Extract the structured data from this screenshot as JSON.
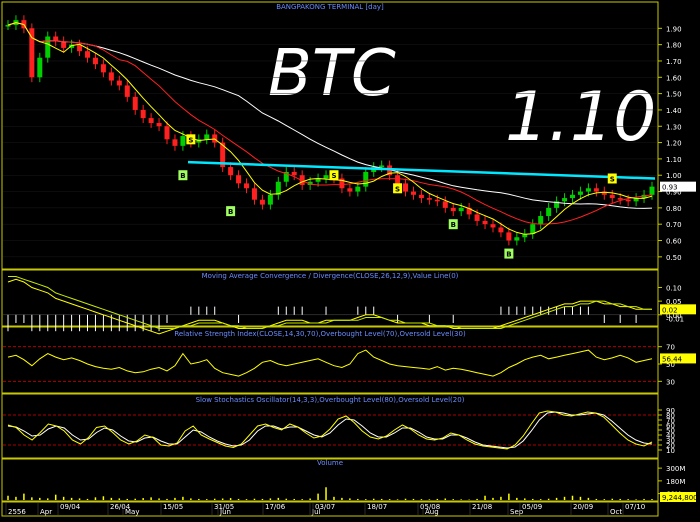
{
  "header": {
    "title": "BANGPAKONG TERMINAL [day]",
    "symbol": "BTC",
    "price": "1.10"
  },
  "colors": {
    "background": "#000000",
    "border": "#c8c800",
    "candle_up": "#00d000",
    "candle_down": "#ff2020",
    "ma_fast": "#ffff00",
    "ma_mid": "#ff2020",
    "ma_slow": "#ffffff",
    "trendline": "#00e8ff",
    "signal_box": "#ffff00",
    "signal_box_buy": "#a0ff60",
    "grid_red": "#b00000",
    "axis_text": "#ffffff",
    "title_blue": "#6a8cff"
  },
  "chart_data": [
    {
      "type": "candlestick",
      "panel": "price",
      "title": "BANGPAKONG TERMINAL [day]",
      "ylim": [
        0.45,
        2.0
      ],
      "yticks": [
        1.9,
        1.8,
        1.7,
        1.6,
        1.5,
        1.4,
        1.3,
        1.2,
        1.1,
        1.0,
        0.9,
        0.8,
        0.7,
        0.6,
        0.5
      ],
      "close_series": [
        1.92,
        1.95,
        1.9,
        1.6,
        1.72,
        1.85,
        1.82,
        1.78,
        1.8,
        1.76,
        1.72,
        1.68,
        1.63,
        1.58,
        1.55,
        1.48,
        1.4,
        1.35,
        1.32,
        1.3,
        1.22,
        1.18,
        1.24,
        1.2,
        1.22,
        1.25,
        1.2,
        1.05,
        1.0,
        0.95,
        0.92,
        0.85,
        0.82,
        0.88,
        0.96,
        1.02,
        1.0,
        0.94,
        0.96,
        0.98,
        1.0,
        0.98,
        0.92,
        0.9,
        0.93,
        1.02,
        1.05,
        1.06,
        1.0,
        0.95,
        0.9,
        0.88,
        0.86,
        0.85,
        0.84,
        0.8,
        0.78,
        0.8,
        0.76,
        0.72,
        0.7,
        0.68,
        0.65,
        0.6,
        0.62,
        0.64,
        0.7,
        0.75,
        0.8,
        0.84,
        0.86,
        0.88,
        0.9,
        0.92,
        0.9,
        0.88,
        0.86,
        0.85,
        0.84,
        0.86,
        0.88,
        0.93
      ],
      "current_value": "0.93",
      "trendline": {
        "from": 1.08,
        "to": 0.98
      },
      "signals": [
        {
          "label": "S",
          "value": 1.22,
          "index": 23
        },
        {
          "label": "B",
          "value": 1.0,
          "index": 22
        },
        {
          "label": "B",
          "value": 0.78,
          "index": 28
        },
        {
          "label": "S",
          "value": 1.0,
          "index": 41
        },
        {
          "label": "S",
          "value": 0.92,
          "index": 49
        },
        {
          "label": "B",
          "value": 0.7,
          "index": 56
        },
        {
          "label": "B",
          "value": 0.52,
          "index": 63
        },
        {
          "label": "S",
          "value": 0.98,
          "index": 76
        }
      ]
    },
    {
      "type": "line",
      "panel": "macd",
      "title": "Moving Average Convergence / Divergence(CLOSE,26,12,9),Value Line(0)",
      "ylim": [
        -0.03,
        0.12
      ],
      "yticks": [
        0.1,
        0.05,
        0.0
      ],
      "current_value": "0.02",
      "current_value_2": "-0.01",
      "macd": [
        0.12,
        0.13,
        0.12,
        0.1,
        0.09,
        0.08,
        0.06,
        0.05,
        0.04,
        0.03,
        0.02,
        0.01,
        0.0,
        -0.01,
        -0.02,
        -0.03,
        -0.04,
        -0.05,
        -0.06,
        -0.07,
        -0.06,
        -0.05,
        -0.04,
        -0.03,
        -0.02,
        -0.02,
        -0.02,
        -0.03,
        -0.04,
        -0.05,
        -0.05,
        -0.05,
        -0.05,
        -0.04,
        -0.03,
        -0.02,
        -0.02,
        -0.02,
        -0.03,
        -0.03,
        -0.02,
        -0.02,
        -0.02,
        -0.02,
        -0.01,
        0.0,
        0.0,
        -0.01,
        -0.02,
        -0.03,
        -0.03,
        -0.03,
        -0.03,
        -0.04,
        -0.04,
        -0.04,
        -0.05,
        -0.05,
        -0.05,
        -0.05,
        -0.05,
        -0.05,
        -0.04,
        -0.03,
        -0.02,
        -0.01,
        0.0,
        0.01,
        0.02,
        0.03,
        0.04,
        0.04,
        0.05,
        0.05,
        0.05,
        0.04,
        0.04,
        0.03,
        0.03,
        0.02,
        0.02,
        0.02
      ],
      "signal_line": [
        0.14,
        0.14,
        0.13,
        0.12,
        0.11,
        0.1,
        0.08,
        0.07,
        0.06,
        0.05,
        0.04,
        0.03,
        0.02,
        0.01,
        0.0,
        -0.01,
        -0.02,
        -0.03,
        -0.04,
        -0.05,
        -0.05,
        -0.05,
        -0.04,
        -0.04,
        -0.03,
        -0.03,
        -0.03,
        -0.03,
        -0.04,
        -0.04,
        -0.05,
        -0.05,
        -0.05,
        -0.04,
        -0.04,
        -0.03,
        -0.03,
        -0.03,
        -0.03,
        -0.03,
        -0.03,
        -0.02,
        -0.02,
        -0.02,
        -0.02,
        -0.01,
        -0.01,
        -0.01,
        -0.02,
        -0.02,
        -0.03,
        -0.03,
        -0.03,
        -0.03,
        -0.04,
        -0.04,
        -0.04,
        -0.05,
        -0.05,
        -0.05,
        -0.05,
        -0.05,
        -0.05,
        -0.04,
        -0.03,
        -0.02,
        -0.01,
        0.0,
        0.01,
        0.02,
        0.03,
        0.03,
        0.04,
        0.04,
        0.05,
        0.05,
        0.04,
        0.04,
        0.03,
        0.03,
        0.02,
        0.02
      ]
    },
    {
      "type": "line",
      "panel": "rsi",
      "title": "Relative Strength Index(CLOSE,14,30,70),Overbought Level(70),Oversold Level(30)",
      "ylim": [
        20,
        80
      ],
      "yticks": [
        70,
        50,
        30
      ],
      "overbought": 70,
      "oversold": 30,
      "current_value": "56.44",
      "values": [
        58,
        60,
        55,
        48,
        56,
        62,
        58,
        55,
        57,
        54,
        50,
        47,
        45,
        44,
        46,
        42,
        40,
        41,
        44,
        46,
        42,
        48,
        62,
        50,
        52,
        55,
        45,
        40,
        38,
        36,
        40,
        45,
        52,
        54,
        50,
        48,
        50,
        52,
        54,
        56,
        52,
        48,
        46,
        50,
        62,
        66,
        58,
        54,
        50,
        48,
        47,
        46,
        45,
        44,
        47,
        43,
        45,
        44,
        42,
        40,
        38,
        36,
        40,
        46,
        50,
        55,
        58,
        60,
        56,
        58,
        60,
        62,
        64,
        66,
        58,
        55,
        57,
        60,
        57,
        52,
        54,
        56
      ]
    },
    {
      "type": "line",
      "panel": "stochastic",
      "title": "Slow Stochastics Oscillator(14,3,3),Overbought Level(80),Oversold Level(20)",
      "ylim": [
        0,
        100
      ],
      "yticks": [
        90,
        80,
        70,
        60,
        50,
        40,
        30,
        20,
        10
      ],
      "overbought": 80,
      "oversold": 20,
      "k": [
        60,
        55,
        40,
        30,
        45,
        62,
        58,
        48,
        30,
        22,
        35,
        55,
        58,
        45,
        30,
        22,
        28,
        40,
        35,
        20,
        18,
        24,
        48,
        58,
        40,
        32,
        25,
        18,
        15,
        22,
        40,
        58,
        62,
        55,
        50,
        62,
        56,
        44,
        34,
        38,
        52,
        72,
        78,
        65,
        48,
        36,
        32,
        38,
        50,
        60,
        52,
        40,
        32,
        30,
        34,
        44,
        40,
        30,
        22,
        18,
        16,
        14,
        12,
        20,
        38,
        62,
        84,
        88,
        86,
        80,
        78,
        82,
        86,
        84,
        76,
        60,
        44,
        30,
        22,
        18,
        26
      ],
      "d": [
        58,
        56,
        48,
        38,
        40,
        52,
        58,
        54,
        40,
        30,
        32,
        45,
        54,
        50,
        38,
        28,
        26,
        34,
        36,
        28,
        22,
        22,
        36,
        50,
        46,
        36,
        28,
        22,
        18,
        20,
        30,
        48,
        58,
        58,
        52,
        56,
        56,
        48,
        40,
        36,
        44,
        60,
        72,
        70,
        58,
        44,
        36,
        36,
        44,
        54,
        54,
        46,
        36,
        32,
        32,
        40,
        40,
        34,
        26,
        20,
        18,
        16,
        14,
        16,
        28,
        48,
        70,
        84,
        86,
        84,
        80,
        80,
        82,
        84,
        80,
        68,
        54,
        40,
        30,
        24,
        22
      ]
    },
    {
      "type": "bar",
      "panel": "volume",
      "title": "Volume",
      "ylim": [
        0,
        320
      ],
      "yticks_labels": [
        "300M",
        "180M",
        "60M"
      ],
      "yticks_values": [
        300,
        180,
        60
      ],
      "current_value": "9,244,800",
      "values": [
        40,
        30,
        60,
        25,
        20,
        15,
        50,
        30,
        20,
        15,
        10,
        25,
        35,
        20,
        15,
        10,
        12,
        18,
        25,
        15,
        10,
        20,
        30,
        15,
        10,
        8,
        12,
        14,
        18,
        10,
        8,
        12,
        10,
        15,
        20,
        12,
        10,
        8,
        14,
        60,
        120,
        30,
        20,
        15,
        10,
        8,
        12,
        10,
        8,
        6,
        12,
        10,
        8,
        6,
        10,
        14,
        8,
        6,
        4,
        10,
        40,
        20,
        30,
        60,
        20,
        15,
        10,
        8,
        12,
        20,
        30,
        40,
        30,
        20,
        10,
        8,
        12,
        10,
        8,
        6,
        10,
        9
      ]
    }
  ],
  "x_axis": {
    "labels": [
      "2556",
      "09/04",
      "Apr",
      "26/04",
      "May",
      "15/05",
      "31/05",
      "Jun",
      "17/06",
      "Jul",
      "03/07",
      "18/07",
      "05/08",
      "Aug",
      "21/08",
      "Sep",
      "05/09",
      "20/09",
      "Oct",
      "07/10"
    ],
    "label_rows": [
      "row2",
      "row1",
      "row2",
      "row1",
      "row2",
      "row1",
      "row1",
      "row2",
      "row1",
      "row2",
      "row1",
      "row1",
      "row1",
      "row2",
      "row1",
      "row2",
      "row1",
      "row1",
      "row2",
      "row1"
    ]
  }
}
